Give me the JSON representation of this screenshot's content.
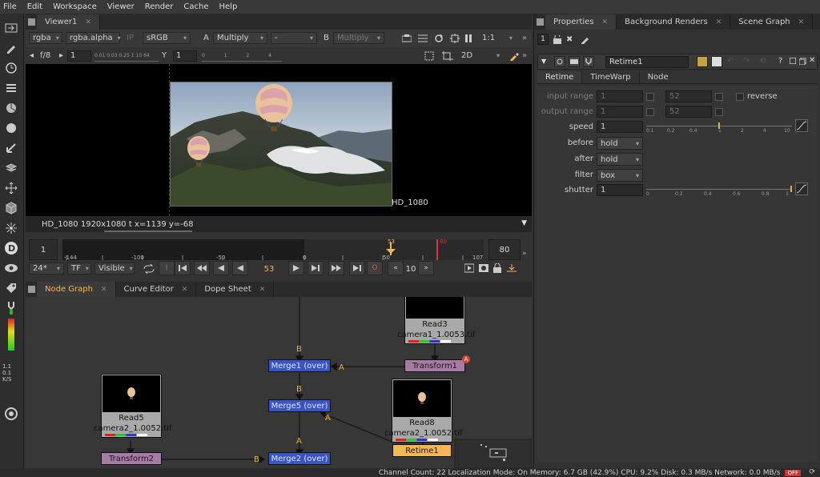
{
  "menu": [
    "File",
    "Edit",
    "Workspace",
    "Viewer",
    "Render",
    "Cache",
    "Help"
  ],
  "viewer_tabs": [
    {
      "label": "Viewer1"
    }
  ],
  "viewer_controls": {
    "channels": "rgba",
    "alpha": "rgba.alpha",
    "ip": "IP",
    "colorspace": "sRGB",
    "input_a_letter": "A",
    "input_a_op": "Multiply",
    "input_a_value": "-",
    "input_b_letter": "B",
    "input_b_op": "Multiply",
    "zoom": "1:1",
    "fstop": "f/8",
    "gain_value": "1",
    "gain_ticks": "0.01 0.03 0.25 1 10 64",
    "gamma_label": "Y",
    "gamma_value": "1",
    "gamma_ticks": "0 1 2 4",
    "view_mode": "2D"
  },
  "viewer": {
    "format_label": "HD_1080",
    "info_text": "HD_1080 1920x1080  t  x=1139 y=-68"
  },
  "timeline": {
    "start": "1",
    "end": "80",
    "ticks": [
      "-144",
      "-100",
      "-50",
      "0",
      "50",
      "107"
    ],
    "current_frame_marker": "53",
    "out_marker": "80",
    "fps": "24*",
    "tf": "TF",
    "visible": "Visible",
    "frame_field": "53",
    "step": "10"
  },
  "node_tabs": [
    {
      "label": "Node Graph"
    },
    {
      "label": "Curve Editor"
    },
    {
      "label": "Dope Sheet"
    }
  ],
  "nodes": {
    "read3": {
      "name": "Read3",
      "file": "camera1_1.0053.tif"
    },
    "read5": {
      "name": "Read5",
      "file": "camera2_1.0052.tif"
    },
    "read8": {
      "name": "Read8",
      "file": "camera2_1.0052.tif"
    },
    "merge1": "Merge1 (over)",
    "merge5": "Merge5 (over)",
    "merge2": "Merge2 (over)",
    "transform1": "Transform1",
    "transform2": "Transform2",
    "retime1": "Retime1",
    "badge": "A"
  },
  "edge_labels": {
    "b1": "B",
    "a1": "A",
    "b5": "B",
    "a5": "A",
    "a2": "A",
    "b2": "B"
  },
  "props_tabs": [
    {
      "label": "Properties"
    },
    {
      "label": "Background Renders"
    },
    {
      "label": "Scene Graph"
    }
  ],
  "props_header": {
    "count": "1",
    "node_name": "Retime1",
    "help": "?"
  },
  "props_subtabs": [
    "Retime",
    "TimeWarp",
    "Node"
  ],
  "retime": {
    "input_range_label": "input range",
    "input_range_a": "1",
    "input_range_b": "52",
    "reverse_label": "reverse",
    "output_range_label": "output range",
    "output_range_a": "1",
    "output_range_b": "52",
    "speed_label": "speed",
    "speed_value": "1",
    "speed_ticks": [
      "0.1",
      "0.2",
      "0.4",
      "1",
      "2",
      "4",
      "10"
    ],
    "before_label": "before",
    "before_value": "hold",
    "after_label": "after",
    "after_value": "hold",
    "filter_label": "filter",
    "filter_value": "box",
    "shutter_label": "shutter",
    "shutter_value": "1",
    "shutter_ticks": [
      "0",
      "0.2",
      "0.4",
      "0.6",
      "0.8",
      "1"
    ]
  },
  "status": {
    "text": "Channel Count: 22  Localization Mode: On  Memory: 6.7 GB (42.9%)  CPU: 9.2%  Disk: 0.3 MB/s  Network: 0.0 MB/s",
    "off": "OFF"
  },
  "left_meter": {
    "l1": "1.1",
    "l2": "0.1",
    "l3": "K/S"
  },
  "colors": {
    "accent": "#f3b75a",
    "merge": "#3a55c0",
    "transform": "#a57aa5"
  }
}
